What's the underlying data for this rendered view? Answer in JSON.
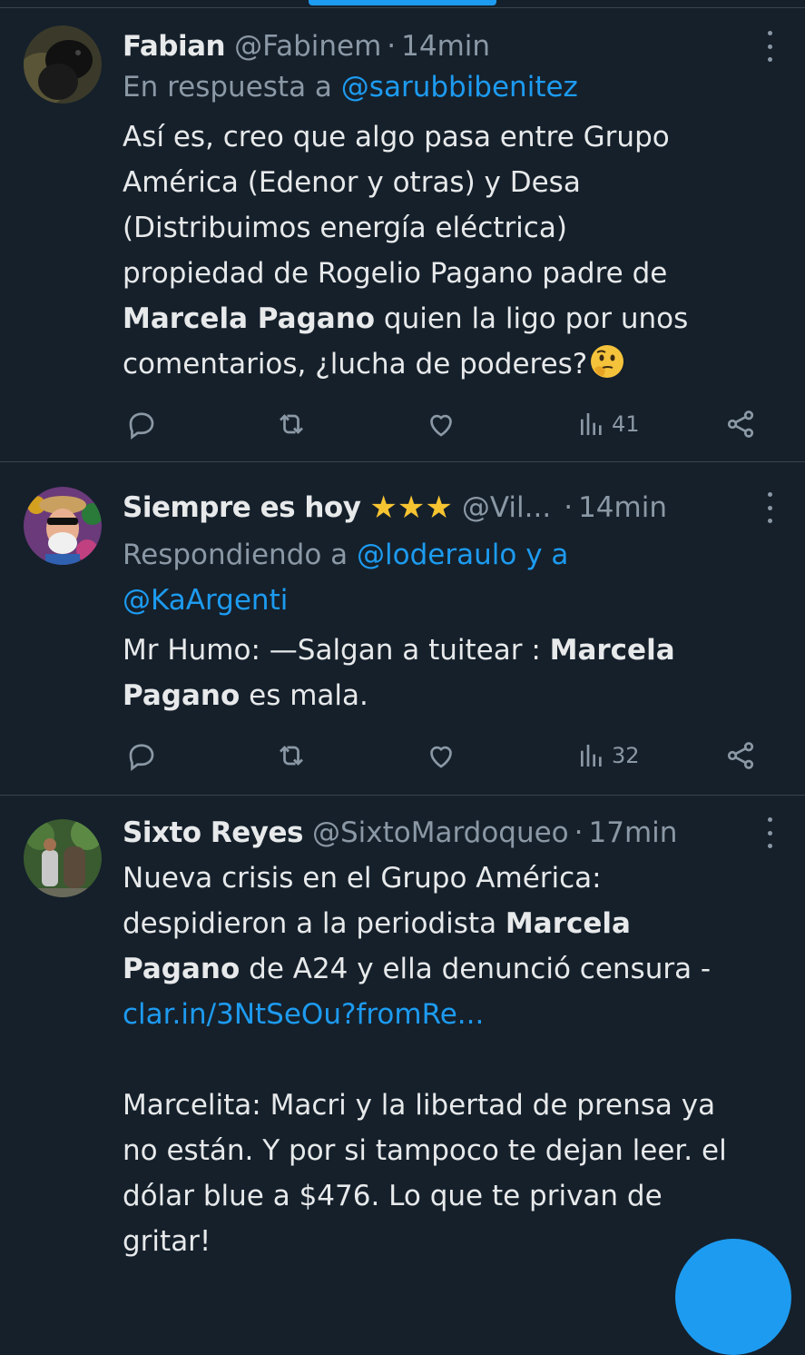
{
  "tweets": [
    {
      "name": "Fabian",
      "handle": "@Fabinem",
      "separator": "·",
      "time": "14min",
      "reply_prefix": "En respuesta a",
      "reply_mention": "@sarubbibenitez",
      "text": {
        "line1": "Así es, creo que algo pasa entre Grupo",
        "line2": "América (Edenor y otras) y Desa",
        "line3": "(Distribuimos energía eléctrica)",
        "line4": "propiedad de Rogelio Pagano padre de",
        "line5_bold": "Marcela Pagano",
        "line5_rest": " quien la ligo por unos",
        "line6": "comentarios, ¿lucha de poderes?"
      },
      "emoji": "thinking-face",
      "views": "41"
    },
    {
      "name": "Siempre es hoy",
      "name_stars": "★★★",
      "handle": "@Vil...",
      "separator": "·",
      "time": "14min",
      "reply_prefix": "Respondiendo a",
      "reply_mention_1": "@loderaulo",
      "reply_join": "y a",
      "reply_mention_2": "@KaArgenti",
      "text": {
        "line1_pre": "Mr Humo: —Salgan a tuitear : ",
        "line1_bold": "Marcela",
        "line2_bold": "Pagano",
        "line2_rest": " es mala."
      },
      "views": "32"
    },
    {
      "name": "Sixto Reyes",
      "handle": "@SixtoMardoqueo",
      "separator": "·",
      "time": "17min",
      "text": {
        "line1": "Nueva crisis en el Grupo América:",
        "line2_pre": "despidieron a la periodista ",
        "line2_bold": "Marcela",
        "line3_bold": "Pagano",
        "line3_rest": " de A24 y ella denunció censura -",
        "line4_link": "clar.in/3NtSeOu?fromRe...",
        "line6": "Marcelita: Macri y la libertad de prensa ya",
        "line7": "no están. Y por si tampoco te dejan leer. el",
        "line8": "dólar blue a $476. Lo que te privan de",
        "line9": "gritar!"
      }
    }
  ],
  "colors": {
    "background": "#15202b",
    "accent": "#1d9bf0",
    "secondary_text": "#8b98a5",
    "divider": "#38444d"
  },
  "icons": [
    "reply-icon",
    "retweet-icon",
    "like-icon",
    "views-icon",
    "share-icon",
    "more-icon",
    "compose-fab"
  ]
}
